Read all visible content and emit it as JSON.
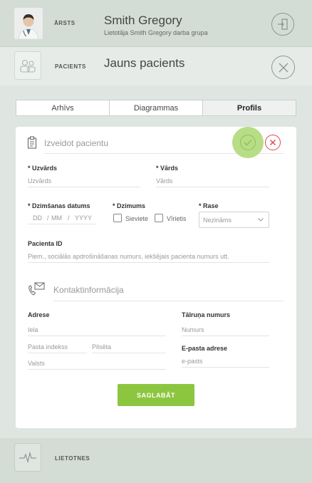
{
  "doctor": {
    "role_label": "ĀRSTS",
    "name": "Smith Gregory",
    "group": "Lietotāja Smith Gregory darba grupa"
  },
  "patient": {
    "role_label": "PACIENTS",
    "title": "Jauns pacients"
  },
  "tabs": [
    {
      "label": "Arhīvs",
      "active": false
    },
    {
      "label": "Diagrammas",
      "active": false
    },
    {
      "label": "Profils",
      "active": true
    }
  ],
  "form": {
    "section_title": "Izveidot pacientu",
    "surname": {
      "label": "* Uzvārds",
      "placeholder": "Uzvārds"
    },
    "firstname": {
      "label": "* Vārds",
      "placeholder": "Vārds"
    },
    "birthdate": {
      "label": "* Dzimšanas datums",
      "dd": "DD",
      "sep1": "/",
      "mm": "MM",
      "sep2": "/",
      "yyyy": "YYYY"
    },
    "gender": {
      "label": "* Dzimums",
      "female": "Sieviete",
      "male": "Vīrietis"
    },
    "race": {
      "label": "* Rase",
      "selected": "Nezināms"
    },
    "patient_id": {
      "label": "Pacienta ID",
      "placeholder": "Piem., sociālās apdrošināšanas numurs, iekšējais pacienta numurs utt."
    }
  },
  "contact": {
    "section_title": "Kontaktinformācija",
    "address": {
      "label": "Adrese",
      "street_placeholder": "Iela",
      "postal_placeholder": "Pasta indekss",
      "city_placeholder": "Pilsēta",
      "country_placeholder": "Valsts"
    },
    "phone": {
      "label": "Tālruņa numurs",
      "placeholder": "Numurs"
    },
    "email": {
      "label": "E-pasta adrese",
      "placeholder": "e-pasts"
    }
  },
  "save_label": "SAGLABĀT",
  "footer": {
    "label": "LIETOTNES"
  },
  "colors": {
    "accent_green": "#8cc63f",
    "cancel_red": "#e0454f",
    "header_bg": "#d3ddd6"
  }
}
